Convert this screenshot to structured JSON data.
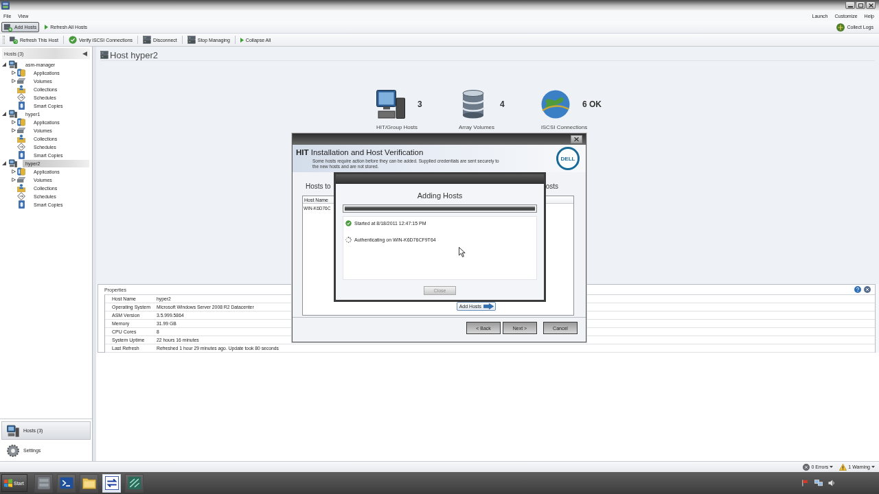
{
  "menu": {
    "left": [
      "File",
      "View"
    ],
    "right": [
      "Launch",
      "Customize",
      "Help"
    ]
  },
  "toolbar": {
    "items": [
      {
        "kind": "add-hosts",
        "label": "Add Hosts",
        "selected": true
      },
      {
        "kind": "refresh-all",
        "label": "Refresh All Hosts",
        "selected": false
      }
    ],
    "collect_logs": "Collect Logs"
  },
  "host_toolbar": [
    {
      "kind": "refresh",
      "label": "Refresh This Host"
    },
    {
      "kind": "verify",
      "label": "Verify iSCSI Connections"
    },
    {
      "kind": "disconnect",
      "label": "Disconnect"
    },
    {
      "kind": "stop",
      "label": "Stop Managing"
    },
    {
      "kind": "collapse",
      "label": "Collapse All"
    }
  ],
  "sidebar": {
    "header": "Hosts (3)",
    "tree": [
      {
        "label": "asm-manager",
        "expanded": true,
        "selected": false,
        "children": [
          {
            "kind": "applications",
            "label": "Applications",
            "expandable": true
          },
          {
            "kind": "volumes",
            "label": "Volumes",
            "expandable": true
          },
          {
            "kind": "collections",
            "label": "Collections",
            "expandable": false
          },
          {
            "kind": "schedules",
            "label": "Schedules",
            "expandable": false
          },
          {
            "kind": "smart-copies",
            "label": "Smart Copies",
            "expandable": false
          }
        ]
      },
      {
        "label": "hyper1",
        "expanded": true,
        "selected": false,
        "children": [
          {
            "kind": "applications",
            "label": "Applications",
            "expandable": true
          },
          {
            "kind": "volumes",
            "label": "Volumes",
            "expandable": true
          },
          {
            "kind": "collections",
            "label": "Collections",
            "expandable": false
          },
          {
            "kind": "schedules",
            "label": "Schedules",
            "expandable": false
          },
          {
            "kind": "smart-copies",
            "label": "Smart Copies",
            "expandable": false
          }
        ]
      },
      {
        "label": "hyper2",
        "expanded": true,
        "selected": true,
        "children": [
          {
            "kind": "applications",
            "label": "Applications",
            "expandable": true
          },
          {
            "kind": "volumes",
            "label": "Volumes",
            "expandable": true
          },
          {
            "kind": "collections",
            "label": "Collections",
            "expandable": false
          },
          {
            "kind": "schedules",
            "label": "Schedules",
            "expandable": false
          },
          {
            "kind": "smart-copies",
            "label": "Smart Copies",
            "expandable": false
          }
        ]
      }
    ],
    "nav": [
      {
        "kind": "hosts",
        "label": "Hosts (3)",
        "selected": true
      },
      {
        "kind": "settings",
        "label": "Settings",
        "selected": false
      }
    ]
  },
  "host": {
    "title": "Host hyper2",
    "summary": [
      {
        "kind": "hosts",
        "value": "3",
        "label": "HIT/Group Hosts"
      },
      {
        "kind": "volumes",
        "value": "4",
        "label": "Array Volumes"
      },
      {
        "kind": "connections",
        "value": "6 OK",
        "label": "iSCSI Connections"
      }
    ]
  },
  "properties": {
    "title": "Properties",
    "rows": [
      {
        "name": "Host Name",
        "value": "hyper2"
      },
      {
        "name": "Operating System",
        "value": "Microsoft Windows Server 2008 R2 Datacenter"
      },
      {
        "name": "ASM Version",
        "value": "3.5.999.5864"
      },
      {
        "name": "Memory",
        "value": "31.99 GB"
      },
      {
        "name": "CPU Cores",
        "value": "8"
      },
      {
        "name": "System Uptime",
        "value": "22 hours 16 minutes"
      },
      {
        "name": "Last Refresh",
        "value": "Refreshed 1 hour 29 minutes ago. Update took 80 seconds"
      }
    ]
  },
  "wizard": {
    "heading": "**HIT** Installation and Host Verification",
    "description": "Some hosts require action before they can be added. Supplied credentials are sent securely to the new hosts and are not stored.",
    "logo": "DELL",
    "section_labels": [
      "Hosts to",
      "osts"
    ],
    "table": {
      "columns": [
        "Host Name"
      ],
      "rows": [
        [
          "WIN-K6D76C"
        ]
      ]
    },
    "add_button": "Add Hosts",
    "buttons": [
      "< Back",
      "Next >",
      "Cancel"
    ]
  },
  "progress": {
    "title": "Adding Hosts",
    "level": 1,
    "steps": [
      {
        "kind": "done",
        "text": "Started at 8/18/2011 12:47:15 PM"
      },
      {
        "kind": "running",
        "text": "Authenticating on WIN-K6D76CF9T64"
      }
    ],
    "close": {
      "label": "Close",
      "disabled": true
    }
  },
  "status_bar": [
    {
      "kind": "error",
      "label": "0 Errors"
    },
    {
      "kind": "warning",
      "label": "1 Warning"
    }
  ],
  "taskbar": {
    "start": "Start",
    "apps": [
      {
        "kind": "server",
        "selected": false
      },
      {
        "kind": "terminal",
        "selected": false
      },
      {
        "kind": "folder",
        "selected": false
      },
      {
        "kind": "arrows",
        "selected": true
      },
      {
        "kind": "hatched",
        "selected": false
      }
    ]
  }
}
